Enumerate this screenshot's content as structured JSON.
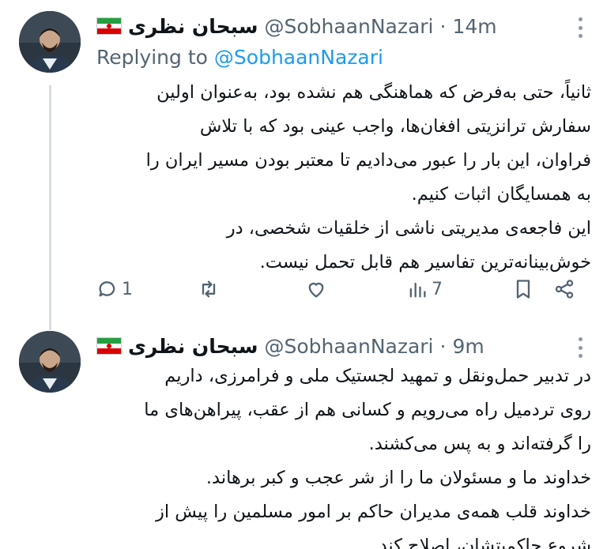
{
  "tweets": [
    {
      "author": {
        "name": "سبحان نظری",
        "handle": "@SobhaanNazari",
        "time": "14m",
        "flag_colors": [
          "#239f40",
          "#ffffff",
          "#da0000"
        ]
      },
      "reply": {
        "prefix": "Replying to",
        "handle": "@SobhaanNazari"
      },
      "lines": [
        "ثانیاً، حتی به‌فرض که هماهنگی هم نشده بود، به‌عنوان اولین",
        "سفارش ترانزیتی افغان‌ها، واجب عینی بود که با تلاش",
        "فراوان، این بار را عبور می‌دادیم تا معتبر بودن مسیر ایران را",
        "به همسایگان اثبات کنیم.",
        "این فاجعه‌ی مدیریتی ناشی از خلقیات شخصی، در",
        "خوش‌بینانه‌ترین تفاسیر هم قابل تحمل نیست."
      ],
      "actions": {
        "replies": "1",
        "retweets": "",
        "likes": "",
        "views": "7",
        "icons": [
          "comment-icon",
          "retweet-icon",
          "heart-icon",
          "views-icon",
          "bookmark-icon",
          "share-icon"
        ]
      }
    },
    {
      "author": {
        "name": "سبحان نظری",
        "handle": "@SobhaanNazari",
        "time": "9m",
        "flag_colors": [
          "#239f40",
          "#ffffff",
          "#da0000"
        ]
      },
      "lines": [
        "در تدبیر حمل‌ونقل و تمهید لجستیک ملی و فرامرزی، داریم",
        "روی تردمیل راه می‌رویم و کسانی هم از عقب، پیراهن‌های ما",
        "را گرفته‌اند و به پس می‌کشند.",
        "خداوند ما و مسئولان ما را از شر عجب و کبر برهاند.",
        "خداوند قلب همه‌ی مدیران حاکم بر امور مسلمین را پیش از",
        "شروع حاکمیتشان، اصلاح کند."
      ]
    }
  ],
  "colors": {
    "text": "#0f1419",
    "muted": "#536471",
    "link": "#1d9bf0",
    "thread_line": "#d8dde1"
  }
}
